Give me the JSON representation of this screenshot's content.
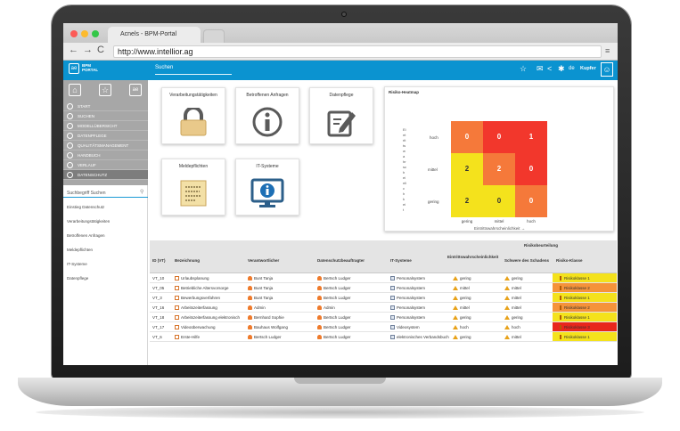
{
  "browser": {
    "tab_title": "Acnels - BPM-Portal",
    "url": "http://www.intellior.ag",
    "back_icon": "arrow-left-icon",
    "forward_icon": "arrow-right-icon",
    "reload_icon": "reload-icon",
    "menu_icon": "hamburger-icon"
  },
  "header": {
    "logo_mark": "ae",
    "logo_line1": "BPM",
    "logo_line2": "PORTAL",
    "search_label": "Suchen",
    "user_name": "Kupfer",
    "colors": {
      "header": "#0b93d0",
      "sidebar": "#a7a7a7"
    }
  },
  "sidebar": {
    "quick": [
      "⌂",
      "☆",
      "ae"
    ],
    "items": [
      {
        "label": "START",
        "active": false
      },
      {
        "label": "SUCHEN",
        "active": false
      },
      {
        "label": "MODELLÜBERSICHT",
        "active": false
      },
      {
        "label": "DATENPFLEGE",
        "active": false
      },
      {
        "label": "QUALITÄTSMANAGEMENT",
        "active": false
      },
      {
        "label": "HANDBUCH",
        "active": false
      },
      {
        "label": "VERLAUF",
        "active": false
      },
      {
        "label": "DATENSCHUTZ",
        "active": true
      }
    ],
    "search_placeholder": "Suchbegriff Suchen",
    "links": [
      "Einstieg Datenschutz",
      "Verarbeitungstätigkeiten",
      "Betroffenen Anfragen",
      "Meldepflichten",
      "IT-Systeme",
      "Datenpflege"
    ]
  },
  "tiles": [
    {
      "label": "Verarbeitungstätigkeiten",
      "icon": "lock-icon"
    },
    {
      "label": "Betroffenen Anfragen",
      "icon": "info-icon"
    },
    {
      "label": "Datenpflege",
      "icon": "edit-document-icon"
    },
    {
      "label": "Meldepflichten",
      "icon": "note-icon"
    },
    {
      "label": "IT-Systeme",
      "icon": "monitor-info-icon"
    }
  ],
  "heatmap": {
    "title": "Risiko-Heatmap",
    "y_axis": "Eintrittswahrscheinlichkeit",
    "x_axis": "Eintrittswahrscheinlichkeit →",
    "rows": [
      "hoch",
      "mittel",
      "gering"
    ],
    "cols": [
      "gering",
      "mittel",
      "hoch"
    ],
    "cells": [
      [
        "0",
        "0",
        "1"
      ],
      [
        "2",
        "2",
        "0"
      ],
      [
        "2",
        "0",
        "0"
      ]
    ],
    "colors": [
      [
        "#f5793a",
        "#f2372c",
        "#f2372c"
      ],
      [
        "#f4e21c",
        "#f5793a",
        "#f2372c"
      ],
      [
        "#f4e21c",
        "#f4e21c",
        "#f5793a"
      ]
    ]
  },
  "table": {
    "group_header": "Risikobeurteilung",
    "headers": [
      "ID (VT)",
      "Bezeichnung",
      "Verantwortlicher",
      "Datenschutzbeauftragter",
      "IT-Systeme",
      "Eintrittswahrscheinlichkeit",
      "Schwere des Schadens",
      "Risiko-Klasse"
    ],
    "rows": [
      {
        "id": "VT_10",
        "name": "Urlaubsplanung",
        "owner": "Bunt Tanja",
        "dpo": "Bertsch Ludger",
        "system": "Personalsystem",
        "prob": "gering",
        "severity": "gering",
        "risk": "Risikoklasse 1",
        "risk_color": "#f4e21c"
      },
      {
        "id": "VT_05",
        "name": "Betriebliche Altersvorsorge",
        "owner": "Bunt Tanja",
        "dpo": "Bertsch Ludger",
        "system": "Personalsystem",
        "prob": "mittel",
        "severity": "mittel",
        "risk": "Risikoklasse 2",
        "risk_color": "#f5933a"
      },
      {
        "id": "VT_3",
        "name": "Bewerbungsverfahren",
        "owner": "Bunt Tanja",
        "dpo": "Bertsch Ludger",
        "system": "Personalsystem",
        "prob": "gering",
        "severity": "mittel",
        "risk": "Risikoklasse 1",
        "risk_color": "#f4e21c"
      },
      {
        "id": "VT_16",
        "name": "Arbeitszeiterfassung",
        "owner": "Admin",
        "dpo": "Admin",
        "system": "Personalsystem",
        "prob": "mittel",
        "severity": "mittel",
        "risk": "Risikoklasse 2",
        "risk_color": "#f5933a"
      },
      {
        "id": "VT_18",
        "name": "Arbeitszeiterfassung elektronisch",
        "owner": "Bernhard Sophie",
        "dpo": "Bertsch Ludger",
        "system": "Personalsystem",
        "prob": "gering",
        "severity": "gering",
        "risk": "Risikoklasse 1",
        "risk_color": "#f4e21c"
      },
      {
        "id": "VT_17",
        "name": "Videoüberwachung",
        "owner": "Bauhaus Wolfgang",
        "dpo": "Bertsch Ludger",
        "system": "Videosystem",
        "prob": "hoch",
        "severity": "hoch",
        "risk": "Risikoklasse 3",
        "risk_color": "#e8261c"
      },
      {
        "id": "VT_6",
        "name": "Erste-Hilfe",
        "owner": "Bertsch Ludger",
        "dpo": "Bertsch Ludger",
        "system": "elektronisches Verbandsbuch",
        "prob": "gering",
        "severity": "mittel",
        "risk": "Risikoklasse 1",
        "risk_color": "#f4e21c"
      }
    ]
  }
}
